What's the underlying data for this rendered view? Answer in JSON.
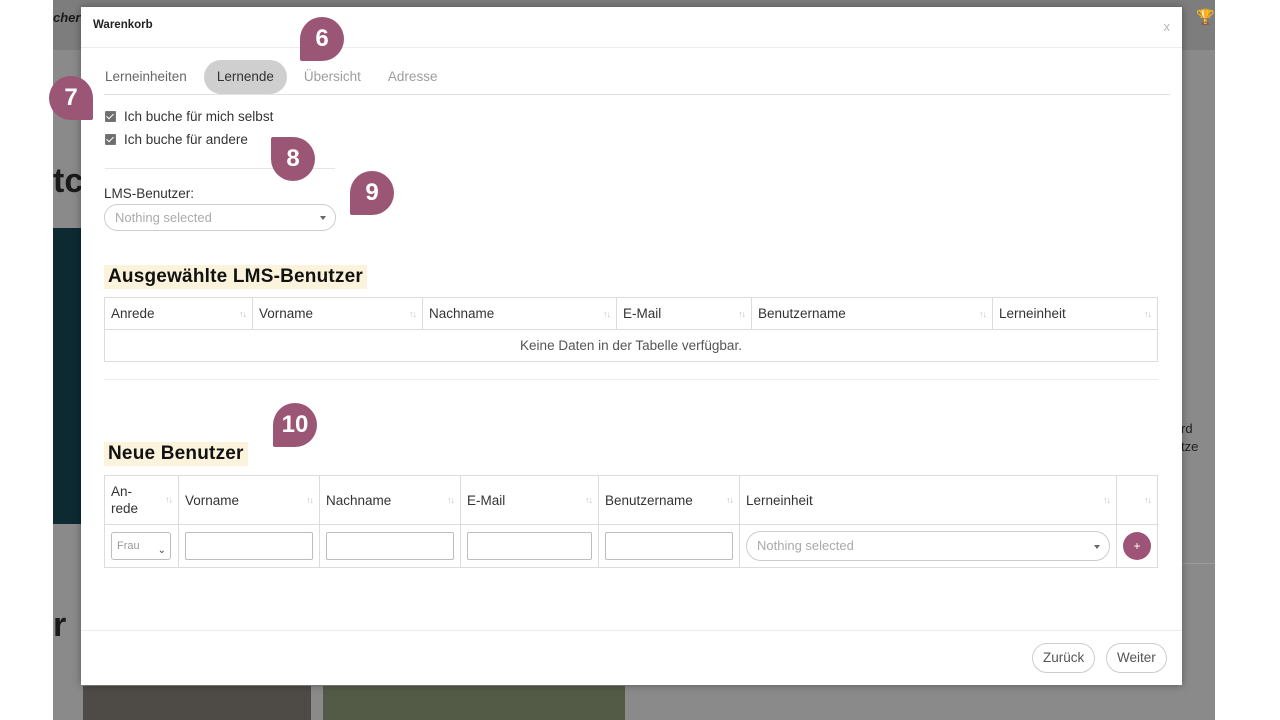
{
  "background": {
    "logo": "cher",
    "big_letters": "tc",
    "big_letters_2": "r",
    "side_text_1": "rd",
    "side_text_2": "tze"
  },
  "modal": {
    "title": "Warenkorb",
    "close": "x"
  },
  "tabs": [
    {
      "label": "Lerneinheiten",
      "state": "normal"
    },
    {
      "label": "Lernende",
      "state": "active"
    },
    {
      "label": "Übersicht",
      "state": "muted"
    },
    {
      "label": "Adresse",
      "state": "muted"
    }
  ],
  "checkboxes": [
    {
      "label": "Ich buche für mich selbst",
      "checked": true
    },
    {
      "label": "Ich buche für andere",
      "checked": true
    }
  ],
  "lms_user": {
    "label": "LMS-Benutzer:",
    "placeholder": "Nothing selected"
  },
  "selected_users": {
    "title": "Ausgewählte LMS-Benutzer",
    "columns": [
      "Anrede",
      "Vorname",
      "Nachname",
      "E-Mail",
      "Benutzername",
      "Lerneinheit"
    ],
    "empty_text": "Keine Daten in der Tabelle verfügbar."
  },
  "new_users": {
    "title": "Neue Benutzer",
    "columns": [
      "An-\nrede",
      "Vorname",
      "Nachname",
      "E-Mail",
      "Benutzername",
      "Lerneinheit",
      ""
    ],
    "salutation_value": "Frau",
    "lerneinheit_placeholder": "Nothing selected",
    "add_label": "+"
  },
  "footer": {
    "back_label": "Zurück",
    "next_label": "Weiter"
  },
  "callouts": [
    "6",
    "7",
    "8",
    "9",
    "10"
  ],
  "colors": {
    "accent": "#9b5676",
    "title_highlight": "#fbf3dc",
    "active_tab_bg": "#cfcfcf"
  },
  "icons": {
    "sort": "sort-arrows-icon",
    "caret": "caret-down-icon",
    "close": "close-icon",
    "add": "plus-icon"
  }
}
